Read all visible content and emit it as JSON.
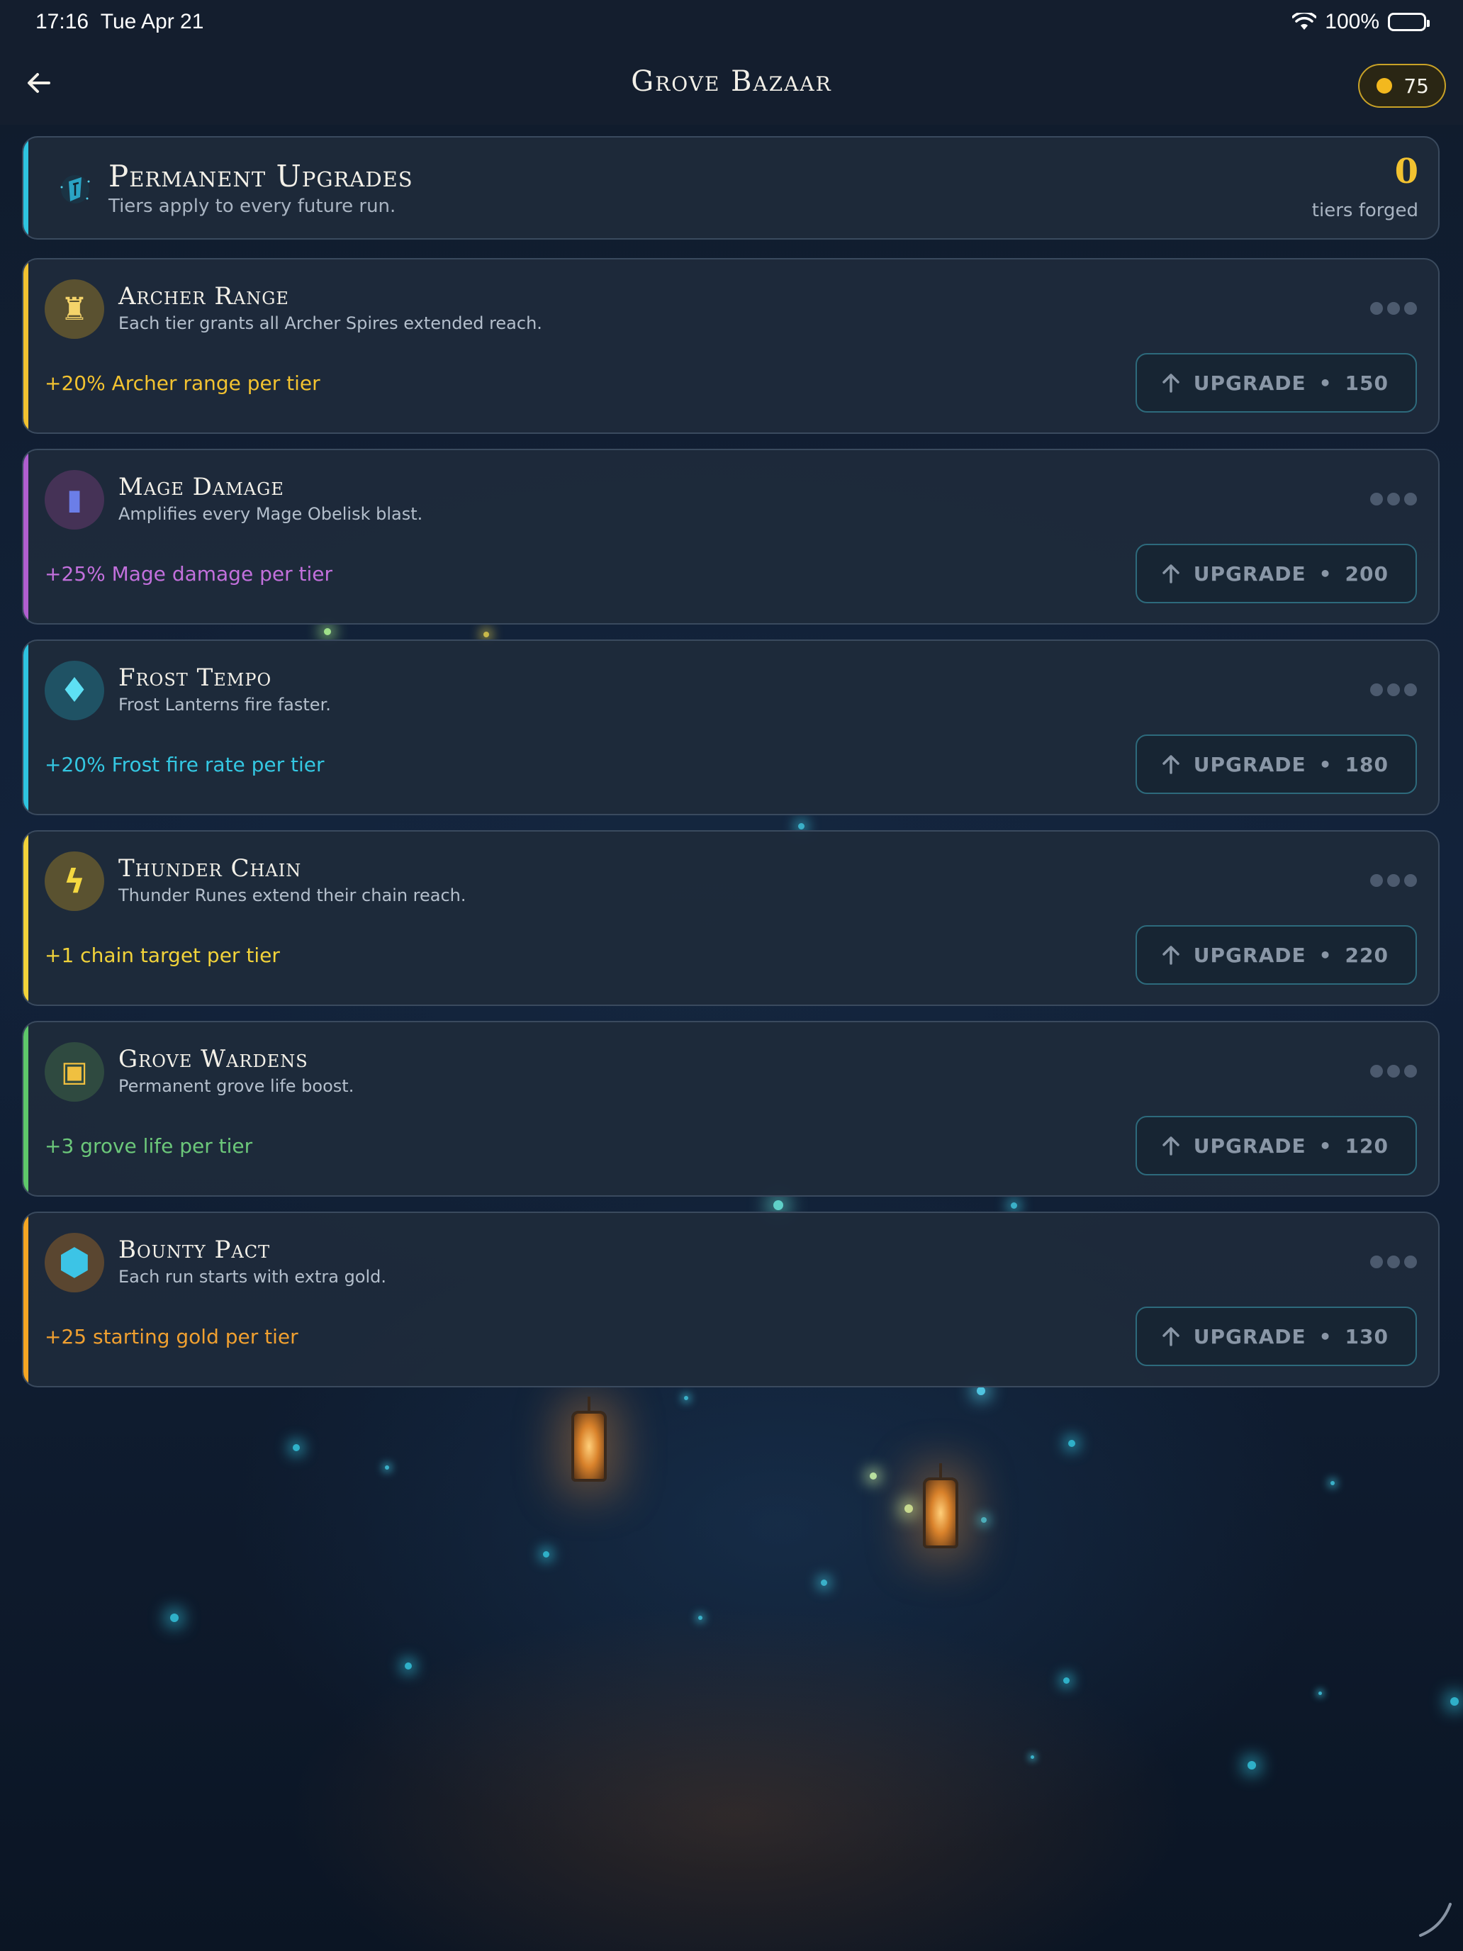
{
  "status_bar": {
    "time": "17:16",
    "date": "Tue Apr 21",
    "battery": "100%"
  },
  "header": {
    "title": "Grove Bazaar",
    "back_icon": "arrow-left-icon",
    "coins": "75",
    "coin_color": "#f3b81e"
  },
  "summary": {
    "title": "Permanent Upgrades",
    "subtitle": "Tiers apply to every future run.",
    "count": "0",
    "count_label": "tiers forged",
    "accent": "#2ec4e0",
    "icon": "rune-crystal-icon"
  },
  "upgrades": [
    {
      "name": "Archer Range",
      "desc": "Each tier grants all Archer Spires extended reach.",
      "effect": "+20% Archer range per tier",
      "button_label": "UPGRADE",
      "cost": "150",
      "accent": "#f2c230",
      "effect_color": "#f2c230",
      "icon_bg": "#5a5130",
      "icon": "archer-tower-icon",
      "icon_glyph": "♜",
      "icon_color": "#f4d36a"
    },
    {
      "name": "Mage Damage",
      "desc": "Amplifies every Mage Obelisk blast.",
      "effect": "+25% Mage damage per tier",
      "button_label": "UPGRADE",
      "cost": "200",
      "accent": "#b05ed0",
      "effect_color": "#c270dc",
      "icon_bg": "#453256",
      "icon": "mage-obelisk-icon",
      "icon_glyph": "▮",
      "icon_color": "#6b7ee8"
    },
    {
      "name": "Frost Tempo",
      "desc": "Frost Lanterns fire faster.",
      "effect": "+20% Frost fire rate per tier",
      "button_label": "UPGRADE",
      "cost": "180",
      "accent": "#2ec4e0",
      "effect_color": "#34c7e2",
      "icon_bg": "#1f5264",
      "icon": "frost-crystal-icon",
      "icon_glyph": "♦",
      "icon_color": "#5ee0f4"
    },
    {
      "name": "Thunder Chain",
      "desc": "Thunder Runes extend their chain reach.",
      "effect": "+1 chain target per tier",
      "button_label": "UPGRADE",
      "cost": "220",
      "accent": "#f2d33a",
      "effect_color": "#f2d33a",
      "icon_bg": "#5a5230",
      "icon": "thunder-rune-icon",
      "icon_glyph": "ϟ",
      "icon_color": "#f4d840"
    },
    {
      "name": "Grove Wardens",
      "desc": "Permanent grove life boost.",
      "effect": "+3 grove life per tier",
      "button_label": "UPGRADE",
      "cost": "120",
      "accent": "#5ec86a",
      "effect_color": "#6cc87a",
      "icon_bg": "#2f4a40",
      "icon": "lantern-icon",
      "icon_glyph": "▣",
      "icon_color": "#f0c040"
    },
    {
      "name": "Bounty Pact",
      "desc": "Each run starts with extra gold.",
      "effect": "+25 starting gold per tier",
      "button_label": "UPGRADE",
      "cost": "130",
      "accent": "#f5a623",
      "effect_color": "#f0a030",
      "icon_bg": "#5a4630",
      "icon": "gold-hexagon-icon",
      "icon_glyph": "⬢",
      "icon_color": "#3cc4e6"
    }
  ]
}
